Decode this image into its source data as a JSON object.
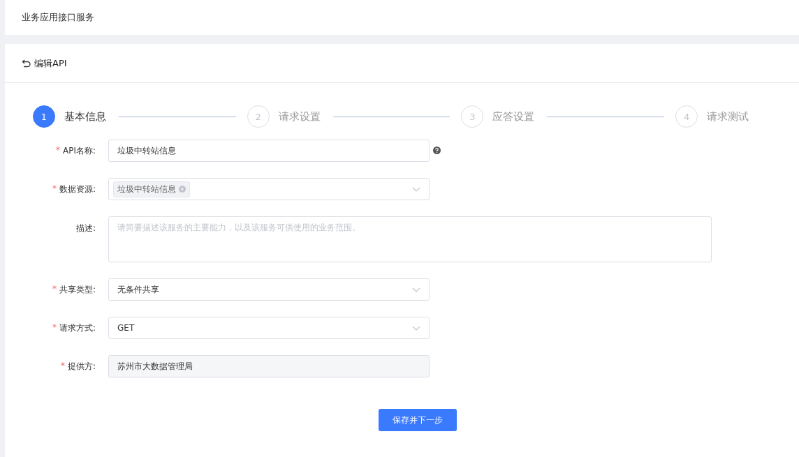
{
  "header": {
    "title": "业务应用接口服务"
  },
  "page": {
    "back_title": "编辑API"
  },
  "steps": [
    {
      "number": "1",
      "label": "基本信息",
      "selected": true
    },
    {
      "number": "2",
      "label": "请求设置",
      "selected": false
    },
    {
      "number": "3",
      "label": "应答设置",
      "selected": false
    },
    {
      "number": "4",
      "label": "请求测试",
      "selected": false
    }
  ],
  "fields": [
    {
      "kind": "text",
      "label": "API名称:",
      "required_mark": "*",
      "value": "垃圾中转站信息",
      "help": true
    },
    {
      "kind": "tags",
      "label": "数据资源:",
      "required_mark": "*",
      "tags": [
        "垃圾中转站信息"
      ]
    },
    {
      "kind": "textarea",
      "label": "描述:",
      "placeholder": "请简要描述该服务的主要能力，以及该服务可供使用的业务范围。"
    },
    {
      "kind": "select",
      "label": "共享类型:",
      "required_mark": "*",
      "value": "无条件共享"
    },
    {
      "kind": "select",
      "label": "请求方式:",
      "required_mark": "*",
      "value": "GET"
    },
    {
      "kind": "readonly",
      "label": "提供方:",
      "required_mark": "*",
      "value": "苏州市大数据管理局"
    }
  ],
  "submit": "保存并下一步"
}
